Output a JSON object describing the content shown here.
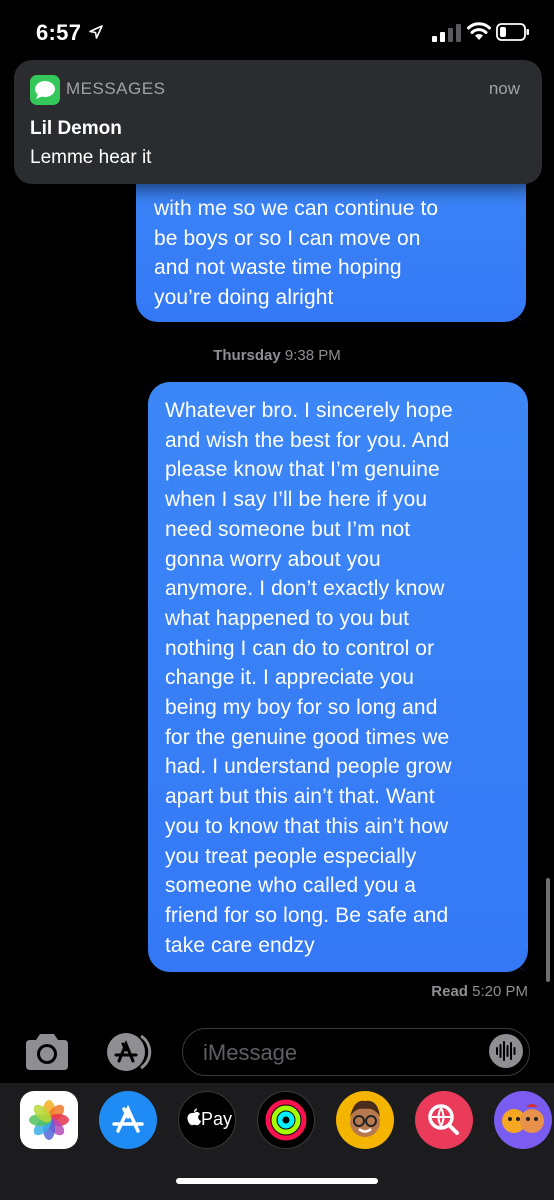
{
  "status_bar": {
    "time": "6:57"
  },
  "notification": {
    "app_name": "MESSAGES",
    "time": "now",
    "sender": "Lil Demon",
    "body": "Lemme hear it"
  },
  "conversation": {
    "message_1_visible_lines": "with me so we can continue to\nbe boys or so I can move on\nand not waste time hoping\nyou’re doing alright",
    "timestamp_day": "Thursday",
    "timestamp_time": "9:38 PM",
    "message_2": "Whatever bro. I sincerely hope\nand wish the best for you. And\nplease know that I’m genuine\nwhen I say I’ll be here if you\nneed someone but I’m not\ngonna worry about you\nanymore. I don’t exactly know\nwhat happened to you but\nnothing I can do to control or\nchange it. I appreciate you\nbeing my boy for so long and\nfor the genuine good times we\nhad. I understand people grow\napart but this ain’t that. Want\nyou to know that this ain’t how\nyou treat people especially\nsomeone who called you a\nfriend for so long. Be safe and\ntake care endzy",
    "read_label": "Read",
    "read_time": "5:20 PM"
  },
  "composer": {
    "placeholder": "iMessage"
  },
  "app_drawer": {
    "items": [
      {
        "name": "photos-app-icon"
      },
      {
        "name": "app-store-app-icon"
      },
      {
        "name": "apple-pay-app-icon",
        "label": "Pay"
      },
      {
        "name": "activity-app-icon"
      },
      {
        "name": "memoji-app-icon"
      },
      {
        "name": "images-search-app-icon"
      },
      {
        "name": "animoji-app-icon"
      }
    ]
  },
  "colors": {
    "bubble_blue": "#3478f6",
    "background": "#000000",
    "notification_bg": "#2b2c30",
    "secondary_text": "#8e8e93"
  }
}
